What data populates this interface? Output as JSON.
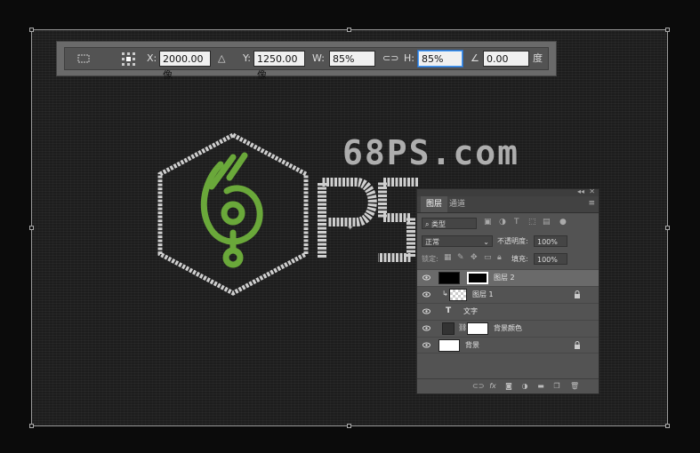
{
  "transform_bar": {
    "x_label": "X:",
    "x_value": "2000.00 像",
    "delta_icon": "delta-triangle-icon",
    "y_label": "Y:",
    "y_value": "1250.00 像",
    "w_label": "W:",
    "w_value": "85%",
    "link_icon": "link-icon",
    "h_label": "H:",
    "h_value": "85%",
    "angle_icon": "angle-icon",
    "angle_value": "0.00",
    "angle_unit": "度"
  },
  "artwork": {
    "site_text": "68PS.com",
    "accent_green": "#6aa83a",
    "text_gray": "#cfcfcf"
  },
  "layers_panel": {
    "tabs": [
      "图层",
      "通道"
    ],
    "filter_placeholder": "类型",
    "blend_mode": "正常",
    "opacity_label": "不透明度:",
    "opacity_value": "100%",
    "lock_label": "锁定:",
    "fill_label": "填充:",
    "fill_value": "100%",
    "layers": [
      {
        "name": "图层 2",
        "selected": true
      },
      {
        "name": "图层 1",
        "selected": false,
        "locked": true
      },
      {
        "name": "文字",
        "selected": false
      },
      {
        "name": "背景颜色",
        "selected": false
      },
      {
        "name": "背景",
        "selected": false,
        "locked": true
      }
    ],
    "footer_icons": [
      "link-layers-icon",
      "fx-icon",
      "mask-icon",
      "adjustment-icon",
      "group-icon",
      "new-layer-icon",
      "trash-icon"
    ]
  }
}
